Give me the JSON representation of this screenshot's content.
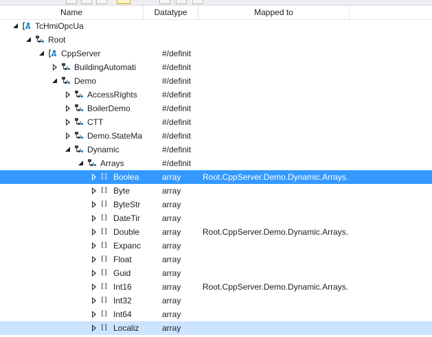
{
  "columns": {
    "name": "Name",
    "datatype": "Datatype",
    "mapped": "Mapped to"
  },
  "rows": [
    {
      "name": "TcHmiOpcUa",
      "datatype": "",
      "mapped": "",
      "level": 0,
      "expander": "open",
      "icon": "opcua-server-icon",
      "state": ""
    },
    {
      "name": "Root",
      "datatype": "",
      "mapped": "",
      "level": 1,
      "expander": "open",
      "icon": "node-folder-icon",
      "state": ""
    },
    {
      "name": "CppServer",
      "datatype": "#/definit",
      "mapped": "",
      "level": 2,
      "expander": "open",
      "icon": "opcua-server-icon",
      "state": ""
    },
    {
      "name": "BuildingAutomati",
      "datatype": "#/definit",
      "mapped": "",
      "level": 3,
      "expander": "closed",
      "icon": "node-folder-icon",
      "state": ""
    },
    {
      "name": "Demo",
      "datatype": "#/definit",
      "mapped": "",
      "level": 3,
      "expander": "open",
      "icon": "node-folder-icon",
      "state": ""
    },
    {
      "name": "AccessRights",
      "datatype": "#/definit",
      "mapped": "",
      "level": 4,
      "expander": "closed",
      "icon": "node-folder-icon",
      "state": ""
    },
    {
      "name": "BoilerDemo",
      "datatype": "#/definit",
      "mapped": "",
      "level": 4,
      "expander": "closed",
      "icon": "node-folder-icon",
      "state": ""
    },
    {
      "name": "CTT",
      "datatype": "#/definit",
      "mapped": "",
      "level": 4,
      "expander": "closed",
      "icon": "node-folder-icon",
      "state": ""
    },
    {
      "name": "Demo.StateMa",
      "datatype": "#/definit",
      "mapped": "",
      "level": 4,
      "expander": "closed",
      "icon": "node-folder-icon",
      "state": ""
    },
    {
      "name": "Dynamic",
      "datatype": "#/definit",
      "mapped": "",
      "level": 4,
      "expander": "open",
      "icon": "node-folder-icon",
      "state": ""
    },
    {
      "name": "Arrays",
      "datatype": "#/definit",
      "mapped": "",
      "level": 5,
      "expander": "open",
      "icon": "node-folder-icon",
      "state": ""
    },
    {
      "name": "Boolea",
      "datatype": "array",
      "mapped": "Root.CppServer.Demo.Dynamic.Arrays.I",
      "level": 6,
      "expander": "closed",
      "icon": "array-icon",
      "state": "selected"
    },
    {
      "name": "Byte",
      "datatype": "array",
      "mapped": "",
      "level": 6,
      "expander": "closed",
      "icon": "array-icon",
      "state": ""
    },
    {
      "name": "ByteStr",
      "datatype": "array",
      "mapped": "",
      "level": 6,
      "expander": "closed",
      "icon": "array-icon",
      "state": ""
    },
    {
      "name": "DateTir",
      "datatype": "array",
      "mapped": "",
      "level": 6,
      "expander": "closed",
      "icon": "array-icon",
      "state": ""
    },
    {
      "name": "Double",
      "datatype": "array",
      "mapped": "Root.CppServer.Demo.Dynamic.Arrays.I",
      "level": 6,
      "expander": "closed",
      "icon": "array-icon",
      "state": ""
    },
    {
      "name": "Expanc",
      "datatype": "array",
      "mapped": "",
      "level": 6,
      "expander": "closed",
      "icon": "array-icon",
      "state": ""
    },
    {
      "name": "Float",
      "datatype": "array",
      "mapped": "",
      "level": 6,
      "expander": "closed",
      "icon": "array-icon",
      "state": ""
    },
    {
      "name": "Guid",
      "datatype": "array",
      "mapped": "",
      "level": 6,
      "expander": "closed",
      "icon": "array-icon",
      "state": ""
    },
    {
      "name": "Int16",
      "datatype": "array",
      "mapped": "Root.CppServer.Demo.Dynamic.Arrays.I",
      "level": 6,
      "expander": "closed",
      "icon": "array-icon",
      "state": ""
    },
    {
      "name": "Int32",
      "datatype": "array",
      "mapped": "",
      "level": 6,
      "expander": "closed",
      "icon": "array-icon",
      "state": ""
    },
    {
      "name": "Int64",
      "datatype": "array",
      "mapped": "",
      "level": 6,
      "expander": "closed",
      "icon": "array-icon",
      "state": ""
    },
    {
      "name": "Localiz",
      "datatype": "array",
      "mapped": "",
      "level": 6,
      "expander": "closed",
      "icon": "array-icon",
      "state": "hover"
    }
  ],
  "array_glyph": "[]",
  "colors": {
    "selected": "#3399ff",
    "hover": "#cce4ff",
    "header_border": "#e4e4e8"
  }
}
